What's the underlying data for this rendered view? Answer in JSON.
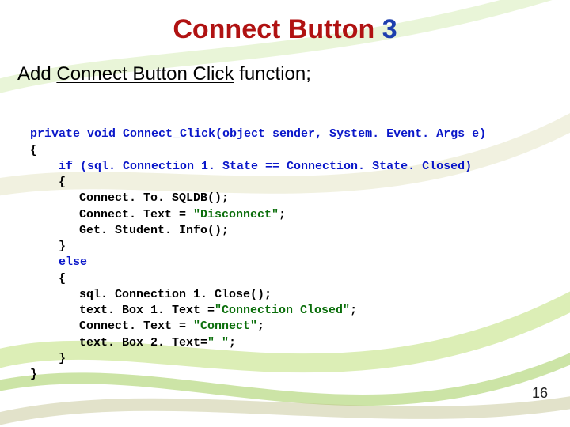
{
  "title": {
    "main": "Connect Button",
    "num": "3"
  },
  "subtitle": {
    "prefix": "Add",
    "underlined": "Connect Button Click",
    "suffix": "function;"
  },
  "code": {
    "l0": "private void Connect_Click(object sender, System. Event. Args e)",
    "l1": "{",
    "l2": "if (sql. Connection 1. State == Connection. State. Closed)",
    "l3": "{",
    "l4": "Connect. To. SQLDB();",
    "l5": "Connect. Text = ",
    "l5s": "\"Disconnect\"",
    "l5e": ";",
    "l6": "Get. Student. Info();",
    "l7": "}",
    "l8": "else",
    "l9": "{",
    "l10": "sql. Connection 1. Close();",
    "l11": "text. Box 1. Text =",
    "l11s": "\"Connection Closed\"",
    "l11e": ";",
    "l12": "Connect. Text = ",
    "l12s": "\"Connect\"",
    "l12e": ";",
    "l13": "text. Box 2. Text=",
    "l13s": "\" \"",
    "l13e": ";",
    "l14": "}",
    "l15": "}"
  },
  "page_number": "16"
}
